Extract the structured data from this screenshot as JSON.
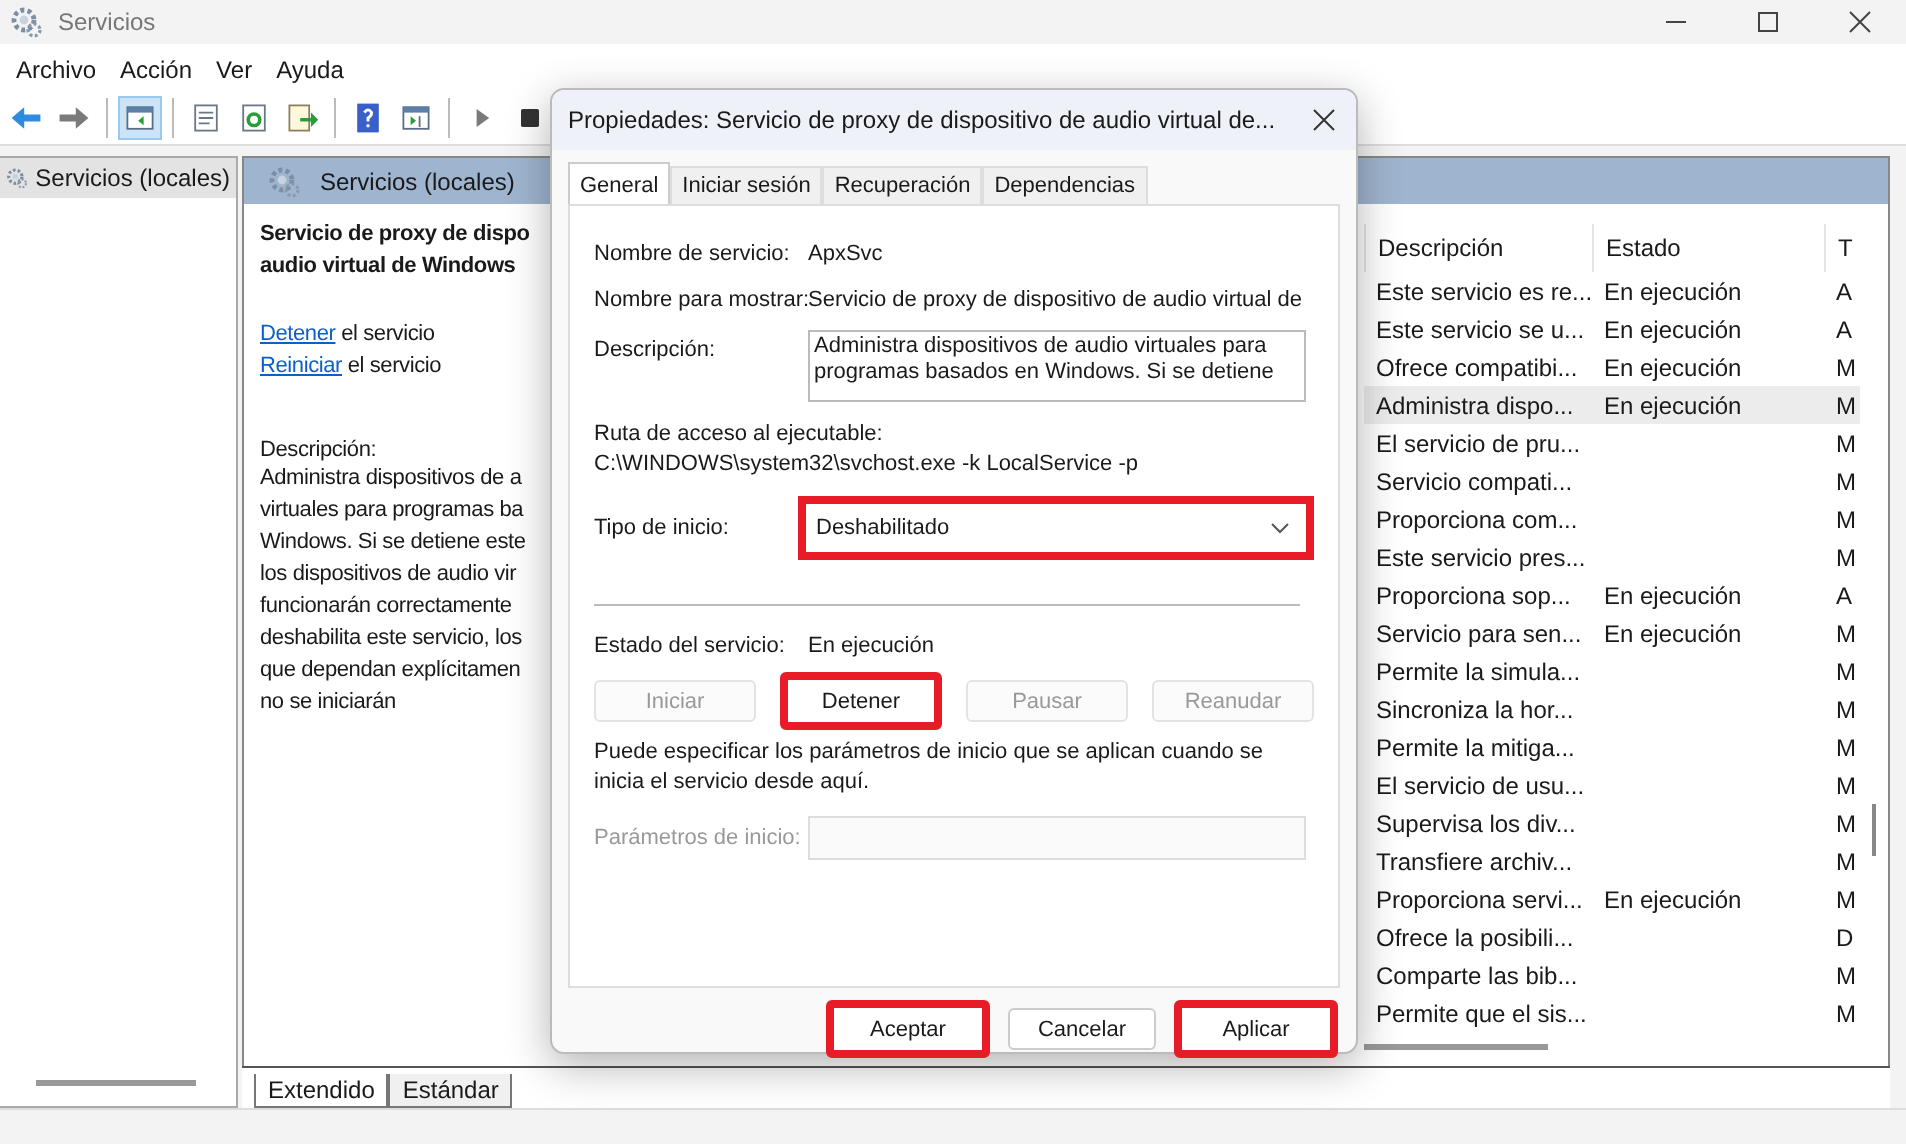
{
  "window": {
    "title": "Servicios"
  },
  "menu": [
    "Archivo",
    "Acción",
    "Ver",
    "Ayuda"
  ],
  "toolbar": [
    {
      "kind": "back",
      "selected": false
    },
    {
      "kind": "forward",
      "selected": false
    },
    {
      "kind": "sep"
    },
    {
      "kind": "tree",
      "selected": true
    },
    {
      "kind": "sep"
    },
    {
      "kind": "properties",
      "selected": false
    },
    {
      "kind": "refresh",
      "selected": false
    },
    {
      "kind": "export",
      "selected": false
    },
    {
      "kind": "sep"
    },
    {
      "kind": "help",
      "selected": false
    },
    {
      "kind": "view",
      "selected": false
    },
    {
      "kind": "sep"
    },
    {
      "kind": "play",
      "selected": false
    },
    {
      "kind": "stop",
      "selected": false
    }
  ],
  "tree": {
    "items": [
      {
        "label": "Servicios (locales)",
        "selected": true
      }
    ]
  },
  "pane": {
    "header": "Servicios (locales)",
    "detail": {
      "title_lines": [
        "Servicio de proxy de dispo",
        "audio virtual de Windows"
      ],
      "actions": [
        {
          "link": "Detener",
          "text": "el servicio"
        },
        {
          "link": "Reiniciar",
          "text": "el servicio"
        }
      ],
      "description_label": "Descripción:",
      "description_lines": [
        "Administra dispositivos de a",
        "virtuales para programas ba",
        "Windows.  Si se detiene este",
        "los dispositivos de audio vir",
        "funcionarán correctamente",
        "deshabilita este servicio, los",
        "que dependan explícitamen",
        "no se iniciarán"
      ]
    },
    "table": {
      "columns": [
        "Descripción",
        "Estado",
        "T"
      ],
      "rows": [
        {
          "cells": [
            "Este servicio es re...",
            "En ejecución",
            "A"
          ],
          "selected": false
        },
        {
          "cells": [
            "Este servicio se u...",
            "En ejecución",
            "A"
          ],
          "selected": false
        },
        {
          "cells": [
            "Ofrece compatibi...",
            "En ejecución",
            "M"
          ],
          "selected": false
        },
        {
          "cells": [
            "Administra dispo...",
            "En ejecución",
            "M"
          ],
          "selected": true
        },
        {
          "cells": [
            "El servicio de pru...",
            "",
            "M"
          ],
          "selected": false
        },
        {
          "cells": [
            "Servicio compati...",
            "",
            "M"
          ],
          "selected": false
        },
        {
          "cells": [
            "Proporciona com...",
            "",
            "M"
          ],
          "selected": false
        },
        {
          "cells": [
            "Este servicio pres...",
            "",
            "M"
          ],
          "selected": false
        },
        {
          "cells": [
            "Proporciona sop...",
            "En ejecución",
            "A"
          ],
          "selected": false
        },
        {
          "cells": [
            "Servicio para sen...",
            "En ejecución",
            "M"
          ],
          "selected": false
        },
        {
          "cells": [
            "Permite la simula...",
            "",
            "M"
          ],
          "selected": false
        },
        {
          "cells": [
            "Sincroniza la hor...",
            "",
            "M"
          ],
          "selected": false
        },
        {
          "cells": [
            "Permite la mitiga...",
            "",
            "M"
          ],
          "selected": false
        },
        {
          "cells": [
            "El servicio de usu...",
            "",
            "M"
          ],
          "selected": false
        },
        {
          "cells": [
            "Supervisa los div...",
            "",
            "M"
          ],
          "selected": false
        },
        {
          "cells": [
            "Transfiere archiv...",
            "",
            "M"
          ],
          "selected": false
        },
        {
          "cells": [
            "Proporciona servi...",
            "En ejecución",
            "M"
          ],
          "selected": false
        },
        {
          "cells": [
            "Ofrece la posibili...",
            "",
            "D"
          ],
          "selected": false
        },
        {
          "cells": [
            "Comparte las bib...",
            "",
            "M"
          ],
          "selected": false
        },
        {
          "cells": [
            "Permite que el sis...",
            "",
            "M"
          ],
          "selected": false
        }
      ]
    },
    "view_tabs": [
      {
        "label": "Extendido",
        "selected": true
      },
      {
        "label": "Estándar",
        "selected": false
      }
    ]
  },
  "dialog": {
    "title": "Propiedades: Servicio de proxy de dispositivo de audio virtual de...",
    "tabs": [
      {
        "label": "General",
        "selected": true
      },
      {
        "label": "Iniciar sesión",
        "selected": false
      },
      {
        "label": "Recuperación",
        "selected": false
      },
      {
        "label": "Dependencias",
        "selected": false
      }
    ],
    "service_name": {
      "label": "Nombre de servicio:",
      "value": "ApxSvc"
    },
    "display_name": {
      "label": "Nombre para mostrar:",
      "value": "Servicio de proxy de dispositivo de audio virtual de"
    },
    "description": {
      "label": "Descripción:",
      "lines": [
        "Administra dispositivos de audio virtuales para",
        "programas basados en Windows.  Si se detiene"
      ]
    },
    "path": {
      "label": "Ruta de acceso al ejecutable:",
      "value": "C:\\WINDOWS\\system32\\svchost.exe -k LocalService -p"
    },
    "startup_type": {
      "label": "Tipo de inicio:",
      "value": "Deshabilitado",
      "highlighted": true
    },
    "status": {
      "label": "Estado del servicio:",
      "value": "En ejecución"
    },
    "control_buttons": [
      {
        "label": "Iniciar",
        "disabled": true,
        "highlighted": false
      },
      {
        "label": "Detener",
        "disabled": false,
        "highlighted": true
      },
      {
        "label": "Pausar",
        "disabled": true,
        "highlighted": false
      },
      {
        "label": "Reanudar",
        "disabled": true,
        "highlighted": false
      }
    ],
    "hint": "Puede especificar los parámetros de inicio que se aplican cuando se inicia el servicio desde aquí.",
    "start_params": {
      "label": "Parámetros de inicio:",
      "disabled": true
    },
    "buttons": [
      {
        "label": "Aceptar",
        "highlighted": true
      },
      {
        "label": "Cancelar",
        "highlighted": false
      },
      {
        "label": "Aplicar",
        "highlighted": true
      }
    ]
  }
}
